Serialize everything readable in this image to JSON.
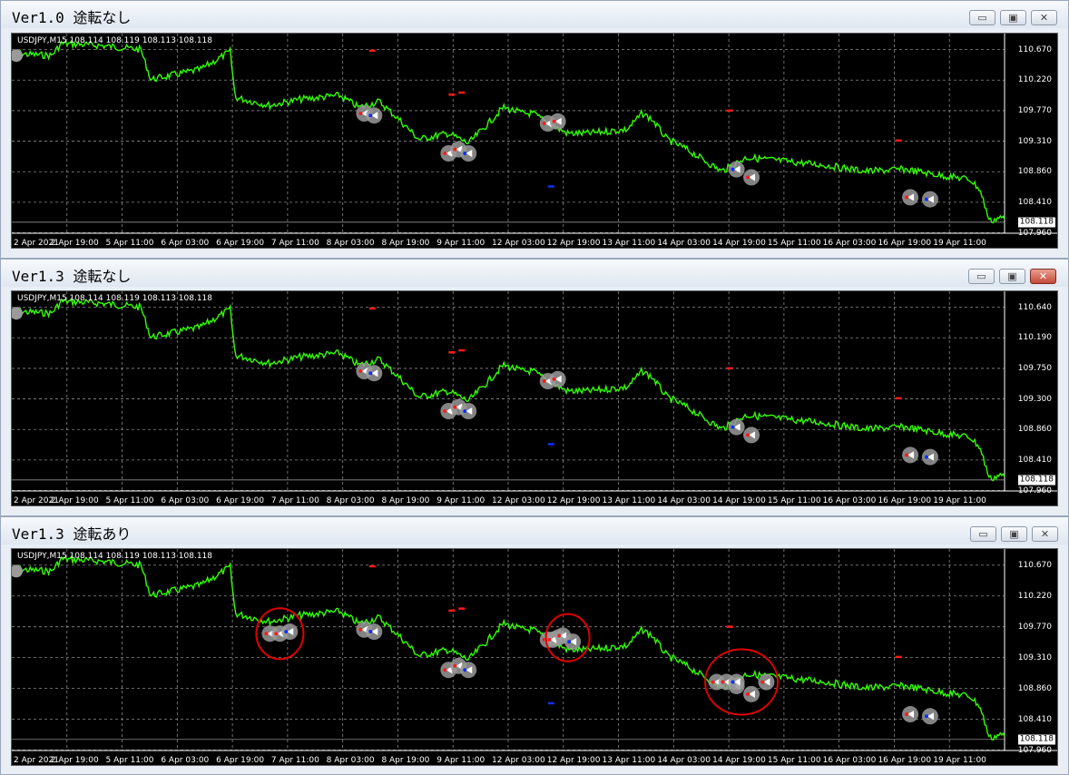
{
  "windows": [
    {
      "title": "Ver1.0 途転なし",
      "symbol_info": "USDJPY,M15  108.114 108.119 108.113 108.118",
      "price_labels": [
        "110.670",
        "110.220",
        "109.770",
        "109.310",
        "108.860",
        "108.410",
        "107.960"
      ],
      "last_price": "108.118",
      "close_highlight": false,
      "circled_areas": []
    },
    {
      "title": "Ver1.3 途転なし",
      "symbol_info": "USDJPY,M15  108.114 108.119 108.113 108.118",
      "price_labels": [
        "110.640",
        "110.190",
        "109.750",
        "109.300",
        "108.860",
        "108.410",
        "107.960"
      ],
      "last_price": "108.118",
      "close_highlight": true,
      "circled_areas": []
    },
    {
      "title": "Ver1.3 途転あり",
      "symbol_info": "USDJPY,M15  108.114 108.119 108.113 108.118",
      "price_labels": [
        "110.670",
        "110.220",
        "109.770",
        "109.310",
        "108.860",
        "108.410",
        "107.960"
      ],
      "last_price": "108.118",
      "close_highlight": false,
      "circled_areas": [
        "reversal-1",
        "reversal-2",
        "reversal-3"
      ]
    }
  ],
  "time_labels": [
    "2 Apr 2021",
    "2 Apr 19:00",
    "5 Apr 11:00",
    "6 Apr 03:00",
    "6 Apr 19:00",
    "7 Apr 11:00",
    "8 Apr 03:00",
    "8 Apr 19:00",
    "9 Apr 11:00",
    "12 Apr 03:00",
    "12 Apr 19:00",
    "13 Apr 11:00",
    "14 Apr 03:00",
    "14 Apr 19:00",
    "15 Apr 11:00",
    "16 Apr 03:00",
    "16 Apr 19:00",
    "19 Apr 11:00"
  ],
  "buttons": {
    "minimize": "▭",
    "restore": "▣",
    "close": "✕"
  },
  "colors": {
    "price_line": "#33ff00",
    "grid": "#8a8a8a",
    "buy": "#1030ff",
    "sell": "#ff1a1a",
    "circle": "#e00000",
    "close_red": "#c2493a"
  }
}
